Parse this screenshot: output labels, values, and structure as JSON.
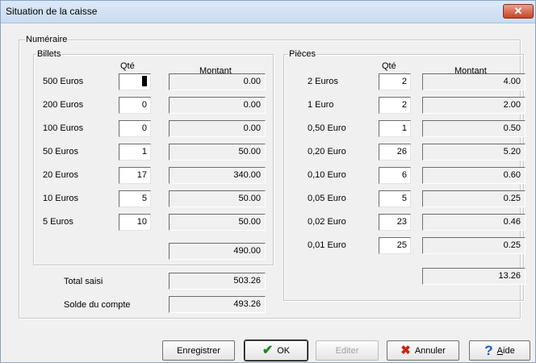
{
  "window": {
    "title": "Situation de la caisse",
    "close_glyph": "✕"
  },
  "numeraire": {
    "legend": "Numéraire"
  },
  "billets": {
    "legend": "Billets",
    "qty_header": "Qté",
    "amount_header": "Montant",
    "rows": [
      {
        "label": "500 Euros",
        "qty": "",
        "amount": "0.00"
      },
      {
        "label": "200 Euros",
        "qty": "0",
        "amount": "0.00"
      },
      {
        "label": "100 Euros",
        "qty": "0",
        "amount": "0.00"
      },
      {
        "label": "50 Euros",
        "qty": "1",
        "amount": "50.00"
      },
      {
        "label": "20 Euros",
        "qty": "17",
        "amount": "340.00"
      },
      {
        "label": "10 Euros",
        "qty": "5",
        "amount": "50.00"
      },
      {
        "label": "5 Euros",
        "qty": "10",
        "amount": "50.00"
      }
    ],
    "subtotal": "490.00"
  },
  "pieces": {
    "legend": "Pièces",
    "qty_header": "Qté",
    "amount_header": "Montant",
    "rows": [
      {
        "label": "2 Euros",
        "qty": "2",
        "amount": "4.00"
      },
      {
        "label": "1 Euro",
        "qty": "2",
        "amount": "2.00"
      },
      {
        "label": "0,50 Euro",
        "qty": "1",
        "amount": "0.50"
      },
      {
        "label": "0,20 Euro",
        "qty": "26",
        "amount": "5.20"
      },
      {
        "label": "0,10 Euro",
        "qty": "6",
        "amount": "0.60"
      },
      {
        "label": "0,05 Euro",
        "qty": "5",
        "amount": "0.25"
      },
      {
        "label": "0,02 Euro",
        "qty": "23",
        "amount": "0.46"
      },
      {
        "label": "0,01 Euro",
        "qty": "25",
        "amount": "0.25"
      }
    ],
    "subtotal": "13.26"
  },
  "totals": {
    "total_saisi_label": "Total saisi",
    "total_saisi": "503.26",
    "solde_label": "Solde du compte",
    "solde": "493.26"
  },
  "buttons": {
    "enregistrer": "Enregistrer",
    "ok": "OK",
    "editer": "Editer",
    "annuler": "Annuler",
    "aide": "Aide"
  },
  "icons": {
    "ok": "check-icon",
    "annuler": "cross-icon",
    "aide": "help-icon"
  },
  "colors": {
    "ok_icon": "#1a8a2a",
    "annuler_icon": "#c8271b",
    "aide_icon": "#1c57c4",
    "close_button": "#c7442a"
  }
}
